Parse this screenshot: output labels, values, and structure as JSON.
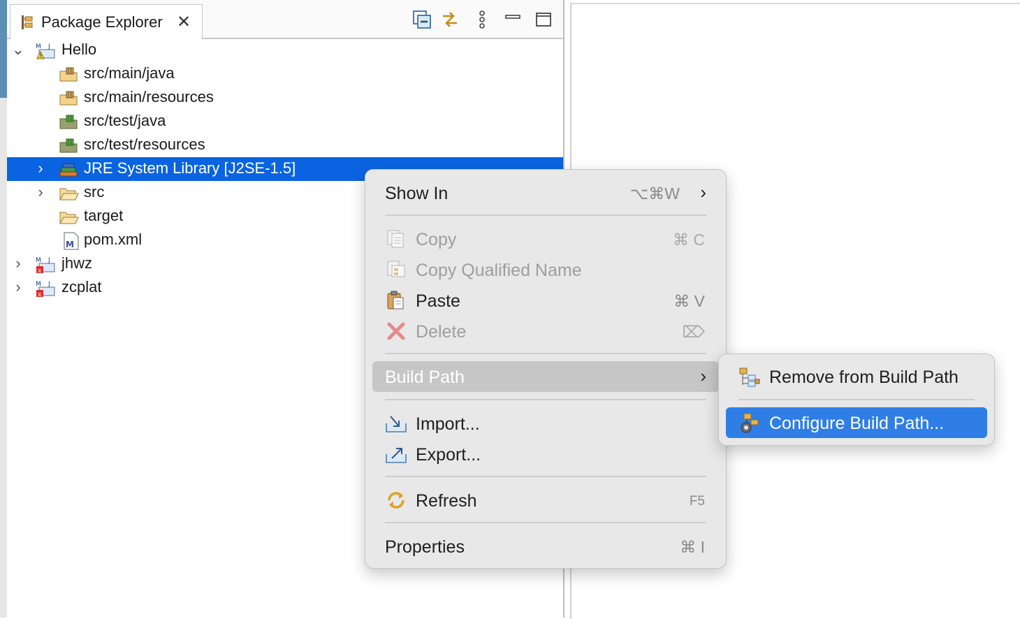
{
  "view": {
    "title": "Package Explorer",
    "toolbar": [
      "collapse-all-icon",
      "link-with-editor-icon",
      "view-menu-icon",
      "minimize-icon",
      "maximize-icon"
    ]
  },
  "tree": {
    "items": [
      {
        "label": "Hello",
        "icon": "maven-project-warning-icon",
        "expanded": true
      },
      {
        "label": "src/main/java",
        "icon": "source-folder-icon"
      },
      {
        "label": "src/main/resources",
        "icon": "source-folder-icon"
      },
      {
        "label": "src/test/java",
        "icon": "test-source-folder-icon"
      },
      {
        "label": "src/test/resources",
        "icon": "test-source-folder-icon"
      },
      {
        "label": "JRE System Library [J2SE-1.5]",
        "icon": "library-icon",
        "selected": true
      },
      {
        "label": "src",
        "icon": "folder-icon"
      },
      {
        "label": "target",
        "icon": "folder-icon"
      },
      {
        "label": "pom.xml",
        "icon": "maven-pom-icon"
      },
      {
        "label": "jhwz",
        "icon": "maven-project-error-icon"
      },
      {
        "label": "zcplat",
        "icon": "maven-project-error-icon"
      }
    ]
  },
  "context_menu": {
    "items": [
      {
        "label": "Show In",
        "shortcut": "⌥⌘W",
        "submenu": true
      },
      {
        "label": "Copy",
        "shortcut": "⌘ C",
        "disabled": true,
        "icon": "copy-icon"
      },
      {
        "label": "Copy Qualified Name",
        "disabled": true,
        "icon": "copy-qualified-name-icon"
      },
      {
        "label": "Paste",
        "shortcut": "⌘ V",
        "icon": "paste-icon"
      },
      {
        "label": "Delete",
        "shortcut": "⌦",
        "disabled": true,
        "icon": "delete-icon"
      },
      {
        "label": "Build Path",
        "submenu": true,
        "highlighted": true
      },
      {
        "label": "Import...",
        "icon": "import-icon"
      },
      {
        "label": "Export...",
        "icon": "export-icon"
      },
      {
        "label": "Refresh",
        "shortcut": "F5",
        "icon": "refresh-icon"
      },
      {
        "label": "Properties",
        "shortcut": "⌘ I"
      }
    ]
  },
  "submenu": {
    "items": [
      {
        "label": "Remove from Build Path",
        "icon": "remove-build-path-icon"
      },
      {
        "label": "Configure Build Path...",
        "icon": "configure-build-path-icon",
        "selected": true
      }
    ]
  },
  "colors": {
    "selection": "#0a64e1",
    "menu_active": "#2f7ee6",
    "menu_hover": "#c6c6c6"
  }
}
